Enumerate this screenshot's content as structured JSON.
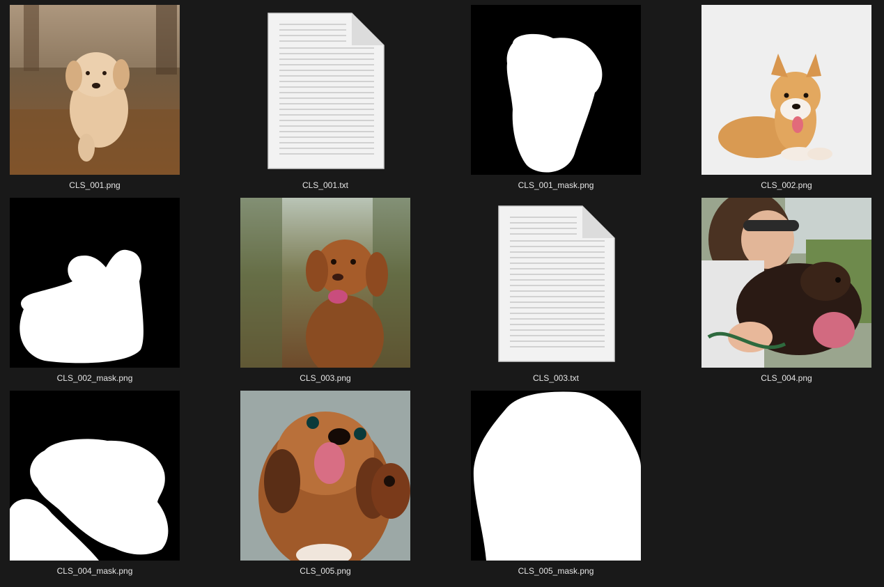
{
  "colors": {
    "background": "#191919",
    "caption_text": "#e6e6e6",
    "mask_background": "#000000",
    "mask_foreground": "#ffffff"
  },
  "files": [
    {
      "name": "CLS_001.png",
      "kind": "photo",
      "icon": "golden-retriever-puppy-photo"
    },
    {
      "name": "CLS_001.txt",
      "kind": "text",
      "icon": "text-document-icon"
    },
    {
      "name": "CLS_001_mask.png",
      "kind": "mask",
      "icon": "mask-image-icon"
    },
    {
      "name": "CLS_002.png",
      "kind": "photo",
      "icon": "corgi-photo"
    },
    {
      "name": "CLS_002_mask.png",
      "kind": "mask",
      "icon": "mask-image-icon"
    },
    {
      "name": "CLS_003.png",
      "kind": "photo",
      "icon": "brown-dog-photo"
    },
    {
      "name": "CLS_003.txt",
      "kind": "text",
      "icon": "text-document-icon"
    },
    {
      "name": "CLS_004.png",
      "kind": "photo",
      "icon": "woman-with-black-dog-photo"
    },
    {
      "name": "CLS_004_mask.png",
      "kind": "mask",
      "icon": "mask-image-icon"
    },
    {
      "name": "CLS_005.png",
      "kind": "photo",
      "icon": "shih-tzu-photo"
    },
    {
      "name": "CLS_005_mask.png",
      "kind": "mask",
      "icon": "mask-image-icon"
    }
  ]
}
